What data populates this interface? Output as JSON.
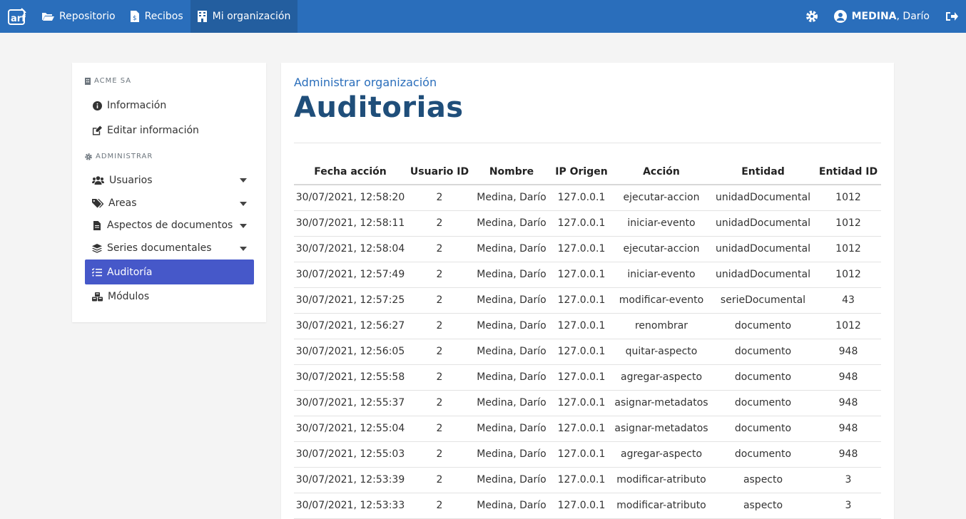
{
  "navbar": {
    "brand_icon": "arf-logo-icon",
    "items": [
      {
        "label": "Repositorio",
        "icon": "folder-open-icon"
      },
      {
        "label": "Recibos",
        "icon": "file-dollar-icon"
      },
      {
        "label": "Mi organización",
        "icon": "building-icon"
      }
    ],
    "user_last": "MEDINA",
    "user_first": ", Darío"
  },
  "sidebar": {
    "org_heading": "ACME SA",
    "admin_heading": "ADMINISTRAR",
    "items": [
      {
        "label": "Información",
        "icon": "info-circle-icon"
      },
      {
        "label": "Editar información",
        "icon": "edit-icon"
      },
      {
        "label": "Usuarios",
        "icon": "users-icon"
      },
      {
        "label": "Areas",
        "icon": "tags-icon"
      },
      {
        "label": "Aspectos de documentos",
        "icon": "file-icon"
      },
      {
        "label": "Series documentales",
        "icon": "layers-icon"
      },
      {
        "label": "Auditoría",
        "icon": "tasks-icon"
      },
      {
        "label": "Módulos",
        "icon": "cubes-icon"
      }
    ]
  },
  "main": {
    "subtitle": "Administrar organización",
    "title": "Auditorias",
    "columns": [
      "Fecha acción",
      "Usuario ID",
      "Nombre",
      "IP Origen",
      "Acción",
      "Entidad",
      "Entidad ID"
    ],
    "rows": [
      [
        "30/07/2021, 12:58:20",
        "2",
        "Medina, Darío",
        "127.0.0.1",
        "ejecutar-accion",
        "unidadDocumental",
        "1012"
      ],
      [
        "30/07/2021, 12:58:11",
        "2",
        "Medina, Darío",
        "127.0.0.1",
        "iniciar-evento",
        "unidadDocumental",
        "1012"
      ],
      [
        "30/07/2021, 12:58:04",
        "2",
        "Medina, Darío",
        "127.0.0.1",
        "ejecutar-accion",
        "unidadDocumental",
        "1012"
      ],
      [
        "30/07/2021, 12:57:49",
        "2",
        "Medina, Darío",
        "127.0.0.1",
        "iniciar-evento",
        "unidadDocumental",
        "1012"
      ],
      [
        "30/07/2021, 12:57:25",
        "2",
        "Medina, Darío",
        "127.0.0.1",
        "modificar-evento",
        "serieDocumental",
        "43"
      ],
      [
        "30/07/2021, 12:56:27",
        "2",
        "Medina, Darío",
        "127.0.0.1",
        "renombrar",
        "documento",
        "1012"
      ],
      [
        "30/07/2021, 12:56:05",
        "2",
        "Medina, Darío",
        "127.0.0.1",
        "quitar-aspecto",
        "documento",
        "948"
      ],
      [
        "30/07/2021, 12:55:58",
        "2",
        "Medina, Darío",
        "127.0.0.1",
        "agregar-aspecto",
        "documento",
        "948"
      ],
      [
        "30/07/2021, 12:55:37",
        "2",
        "Medina, Darío",
        "127.0.0.1",
        "asignar-metadatos",
        "documento",
        "948"
      ],
      [
        "30/07/2021, 12:55:04",
        "2",
        "Medina, Darío",
        "127.0.0.1",
        "asignar-metadatos",
        "documento",
        "948"
      ],
      [
        "30/07/2021, 12:55:03",
        "2",
        "Medina, Darío",
        "127.0.0.1",
        "agregar-aspecto",
        "documento",
        "948"
      ],
      [
        "30/07/2021, 12:53:39",
        "2",
        "Medina, Darío",
        "127.0.0.1",
        "modificar-atributo",
        "aspecto",
        "3"
      ],
      [
        "30/07/2021, 12:53:33",
        "2",
        "Medina, Darío",
        "127.0.0.1",
        "modificar-atributo",
        "aspecto",
        "3"
      ]
    ]
  },
  "colors": {
    "navbar": "#2a6ebb",
    "active_sidebar": "#4658c9",
    "title": "#1f4e7a"
  }
}
